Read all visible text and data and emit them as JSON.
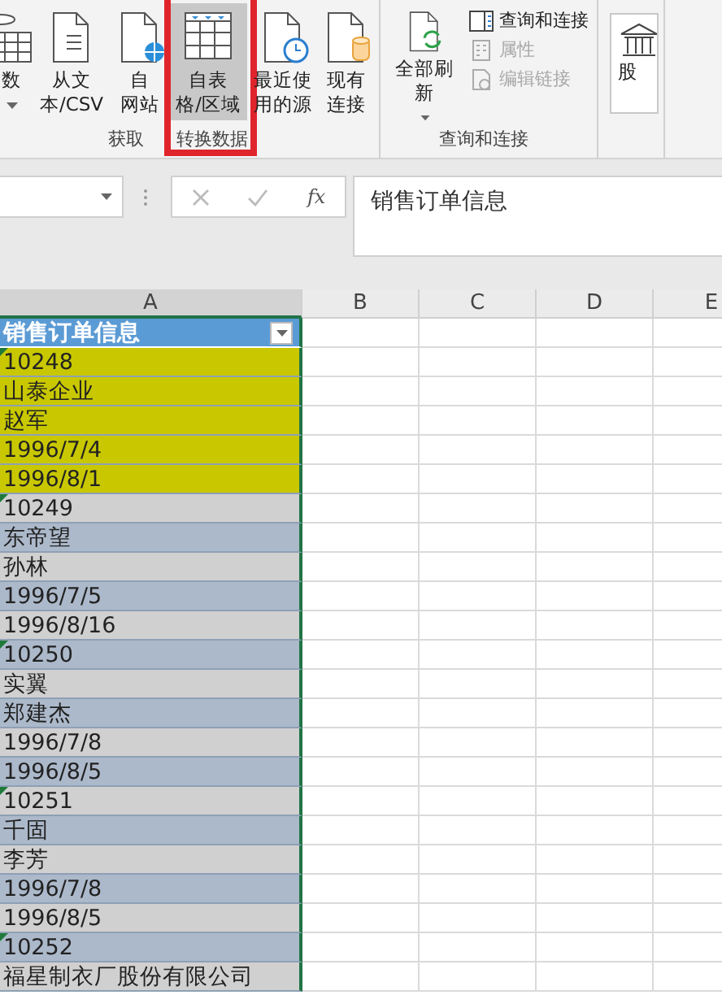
{
  "ribbon": {
    "groups": [
      {
        "label_parts": [
          "获取",
          "转换数据"
        ],
        "buttons": [
          {
            "lines": [
              "数"
            ],
            "dropdown": true,
            "selected": false
          },
          {
            "lines": [
              "从文",
              "本/CSV"
            ],
            "selected": false
          },
          {
            "lines": [
              "自",
              "网站"
            ],
            "selected": false
          },
          {
            "lines": [
              "自表",
              "格/区域"
            ],
            "selected": true,
            "annotated": true
          },
          {
            "lines": [
              "最近使",
              "用的源"
            ],
            "selected": false
          },
          {
            "lines": [
              "现有",
              "连接"
            ],
            "selected": false
          }
        ]
      },
      {
        "label_parts": [
          "查询和连接"
        ],
        "buttons": [
          {
            "lines": [
              "全部刷新"
            ],
            "dropdown": true,
            "selected": false
          }
        ],
        "small_items": [
          {
            "label": "查询和连接",
            "disabled": false
          },
          {
            "label": "属性",
            "disabled": true
          },
          {
            "label": "编辑链接",
            "disabled": true
          }
        ]
      },
      {
        "buttons": [
          {
            "lines": [
              "股"
            ],
            "selected": false
          }
        ]
      }
    ]
  },
  "formula_bar": {
    "function_label": "fx",
    "formula": "销售订单信息"
  },
  "columns": [
    {
      "label": "A",
      "selected": true
    },
    {
      "label": "B",
      "selected": false
    },
    {
      "label": "C",
      "selected": false
    },
    {
      "label": "D",
      "selected": false
    },
    {
      "label": "E",
      "selected": false
    }
  ],
  "header_cell": {
    "text": "销售订单信息",
    "filter": true
  },
  "rows": [
    {
      "text": "10248",
      "color": "#c9c800",
      "flag": true
    },
    {
      "text": "山泰企业",
      "color": "#c9c800",
      "flag": false
    },
    {
      "text": "赵军",
      "color": "#c9c800",
      "flag": false
    },
    {
      "text": "1996/7/4",
      "color": "#c9c800",
      "flag": false
    },
    {
      "text": "1996/8/1",
      "color": "#c9c800",
      "flag": false
    },
    {
      "text": "10249",
      "color": "#d0d0d0",
      "flag": true
    },
    {
      "text": "东帝望",
      "color": "#acb9ca",
      "flag": false
    },
    {
      "text": "孙林",
      "color": "#d0d0d0",
      "flag": false
    },
    {
      "text": "1996/7/5",
      "color": "#acb9ca",
      "flag": false
    },
    {
      "text": "1996/8/16",
      "color": "#d0d0d0",
      "flag": false
    },
    {
      "text": "10250",
      "color": "#acb9ca",
      "flag": true
    },
    {
      "text": "实翼",
      "color": "#d0d0d0",
      "flag": false
    },
    {
      "text": "郑建杰",
      "color": "#acb9ca",
      "flag": false
    },
    {
      "text": "1996/7/8",
      "color": "#d0d0d0",
      "flag": false
    },
    {
      "text": "1996/8/5",
      "color": "#acb9ca",
      "flag": false
    },
    {
      "text": "10251",
      "color": "#d0d0d0",
      "flag": true
    },
    {
      "text": "千固",
      "color": "#acb9ca",
      "flag": false
    },
    {
      "text": "李芳",
      "color": "#d0d0d0",
      "flag": false
    },
    {
      "text": "1996/7/8",
      "color": "#acb9ca",
      "flag": false
    },
    {
      "text": "1996/8/5",
      "color": "#d0d0d0",
      "flag": false
    },
    {
      "text": "10252",
      "color": "#acb9ca",
      "flag": true
    },
    {
      "text": "福星制衣厂股份有限公司",
      "color": "#d0d0d0",
      "flag": false
    }
  ]
}
